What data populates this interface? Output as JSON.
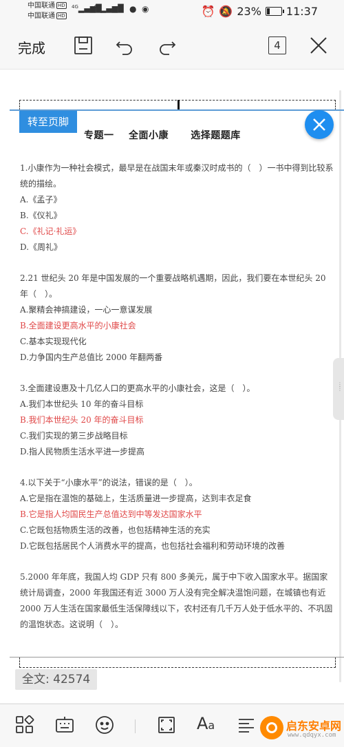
{
  "status": {
    "carrier1": "中国联通",
    "carrier2": "中国联通",
    "hd": "HD",
    "net": "4G",
    "battery_text": "23%",
    "battery_level": 0.23,
    "time": "11:37"
  },
  "toolbar": {
    "done_label": "完成",
    "page_count": "4"
  },
  "doc": {
    "goto_footer_label": "转至页脚",
    "title": "专题一    全面小康      选择题题库",
    "questions": [
      {
        "stem": "1.小康作为一种社会模式，最早是在战国末年或秦汉时成书的（　）一书中得到比较系统的描绘。",
        "options": [
          "A.《孟子》",
          "B.《仪礼》",
          "C.《礼记·礼运》",
          "D.《周礼》"
        ],
        "answer_index": 2
      },
      {
        "stem": "2.21 世纪头 20 年是中国发展的一个重要战略机遇期，因此，我们要在本世纪头 20 年（　）。",
        "options": [
          "A.聚精会神搞建设，一心一意谋发展",
          "B.全面建设更高水平的小康社会",
          "C.基本实现现代化",
          "D.力争国内生产总值比 2000 年翻两番"
        ],
        "answer_index": 1
      },
      {
        "stem": "3.全面建设惠及十几亿人口的更高水平的小康社会，这是（　）。",
        "options": [
          "A.我们本世纪头 10 年的奋斗目标",
          "B.我们本世纪头 20 年的奋斗目标",
          "C.我们实现的第三步战略目标",
          "D.指人民物质生活水平进一步提高"
        ],
        "answer_index": 1
      },
      {
        "stem": "4.以下关于“小康水平”的说法，错误的是（　）。",
        "options": [
          "A.它是指在温饱的基础上，生活质量进一步提高，达到丰衣足食",
          "B.它是指人均国民生产总值达到中等发达国家水平",
          "C.它既包括物质生活的改善，也包括精神生活的充实",
          "D.它既包括居民个人消费水平的提高，也包括社会福利和劳动环境的改善"
        ],
        "answer_index": 1
      },
      {
        "stem": "5.2000 年年底，我国人均 GDP 只有 800 多美元，属于中下收入国家水平。据国家统计局调查，2000 年我国还有近 3000 万人没有完全解决温饱问题，在城镇也有近 2000 万人生活在国家最低生活保障线以下，农村还有几千万人处于低水平的、不巩固的温饱状态。这说明（　）。",
        "options": [],
        "answer_index": -1
      }
    ]
  },
  "wordcount": "全文: 42574",
  "bottom": {
    "font_label": "A",
    "font_label_small": "a"
  },
  "watermark": {
    "name": "启东安卓网",
    "url": "www.qdqyx.com"
  }
}
